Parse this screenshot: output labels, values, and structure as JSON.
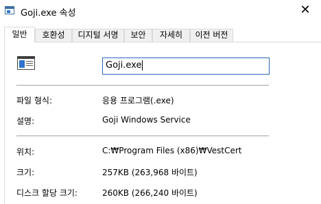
{
  "window": {
    "title": "Goji.exe 속성",
    "close_glyph": "✕"
  },
  "tabs": [
    {
      "label": "일반"
    },
    {
      "label": "호환성"
    },
    {
      "label": "디지털 서명"
    },
    {
      "label": "보안"
    },
    {
      "label": "자세히"
    },
    {
      "label": "이전 버전"
    }
  ],
  "general": {
    "file_icon": "application-window-icon",
    "filename_value": "Goji.exe",
    "rows": [
      {
        "label": "파일 형식:",
        "value": "응용 프로그램(.exe)"
      },
      {
        "label": "설명:",
        "value": "Goji Windows Service"
      },
      {
        "label": "위치:",
        "value": "C:₩Program Files (x86)₩VestCert"
      },
      {
        "label": "크기:",
        "value": "257KB (263,968 바이트)"
      },
      {
        "label": "디스크 할당 크기:",
        "value": "260KB (266,240 바이트)"
      }
    ]
  }
}
